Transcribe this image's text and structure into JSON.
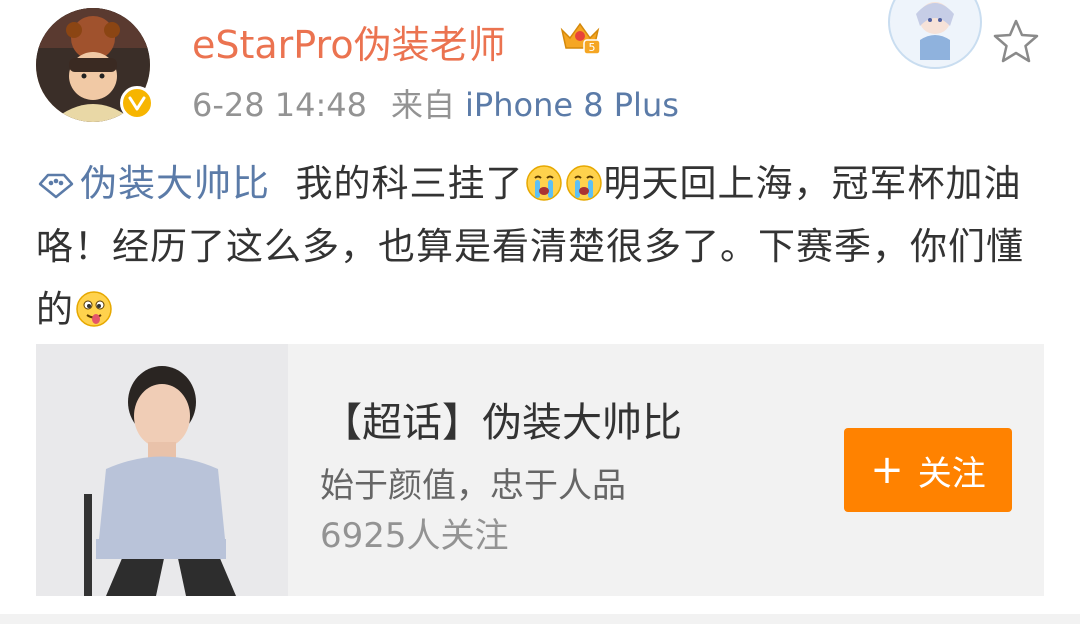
{
  "post": {
    "username": "eStarPro伪装老师",
    "timestamp": "6-28 14:48",
    "source_prefix": "来自",
    "device": "iPhone 8 Plus",
    "topic_link": "伪装大帅比",
    "text_part1": "我的科三挂了",
    "text_part2": "明天回上海，冠军杯加油咯！经历了这么多，也算是看清楚很多了。下赛季，你们懂的",
    "icons": {
      "verified": "verified-badge-icon",
      "crown": "vip-crown-icon",
      "favorite": "star-icon",
      "topic": "super-topic-icon",
      "emoji_cry": "crying-emoji-icon",
      "emoji_tongue": "tongue-emoji-icon"
    }
  },
  "card": {
    "title": "【超话】伪装大帅比",
    "description": "始于颜值，忠于人品",
    "followers": "6925人关注",
    "follow_label": "关注",
    "follow_plus": "+"
  },
  "colors": {
    "username": "#eb7350",
    "link": "#5b7ba8",
    "follow_button": "#ff8200",
    "text": "#333333",
    "meta": "#939393"
  }
}
